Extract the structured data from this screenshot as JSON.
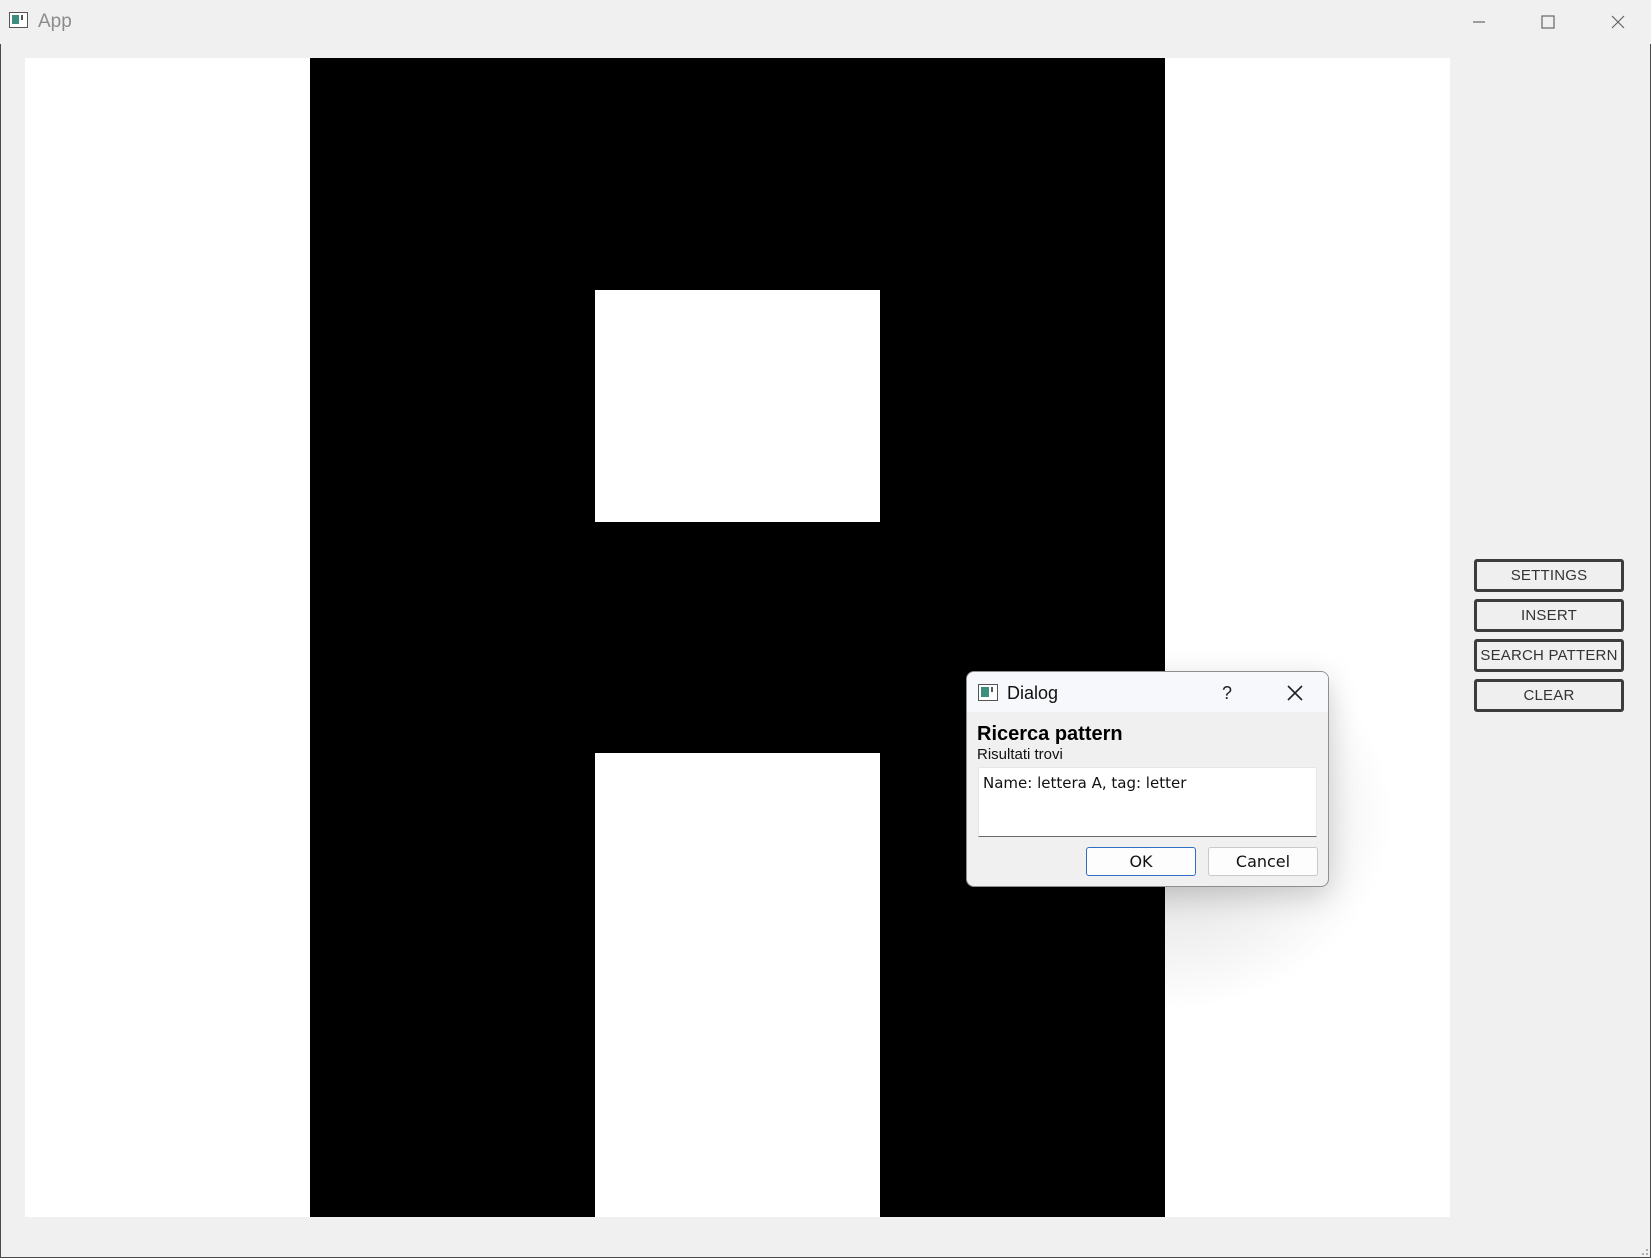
{
  "window": {
    "title": "App",
    "icon": "app-window-icon"
  },
  "window_controls": {
    "minimize_icon": "minimize-icon",
    "maximize_icon": "maximize-icon",
    "close_icon": "close-icon"
  },
  "canvas": {
    "description_colors": {
      "foreground": "#000000",
      "background": "#ffffff"
    }
  },
  "sidebar": {
    "buttons": [
      {
        "id": "settings",
        "label": "SETTINGS"
      },
      {
        "id": "insert",
        "label": "INSERT"
      },
      {
        "id": "search_pattern",
        "label": "SEARCH PATTERN"
      },
      {
        "id": "clear",
        "label": "CLEAR"
      }
    ]
  },
  "dialog": {
    "title": "Dialog",
    "help_label": "?",
    "heading": "Ricerca pattern",
    "subtitle": "Risultati trovi",
    "results": "Name: lettera A, tag: letter",
    "ok_label": "OK",
    "cancel_label": "Cancel",
    "accent_color": "#2f6ec4"
  }
}
